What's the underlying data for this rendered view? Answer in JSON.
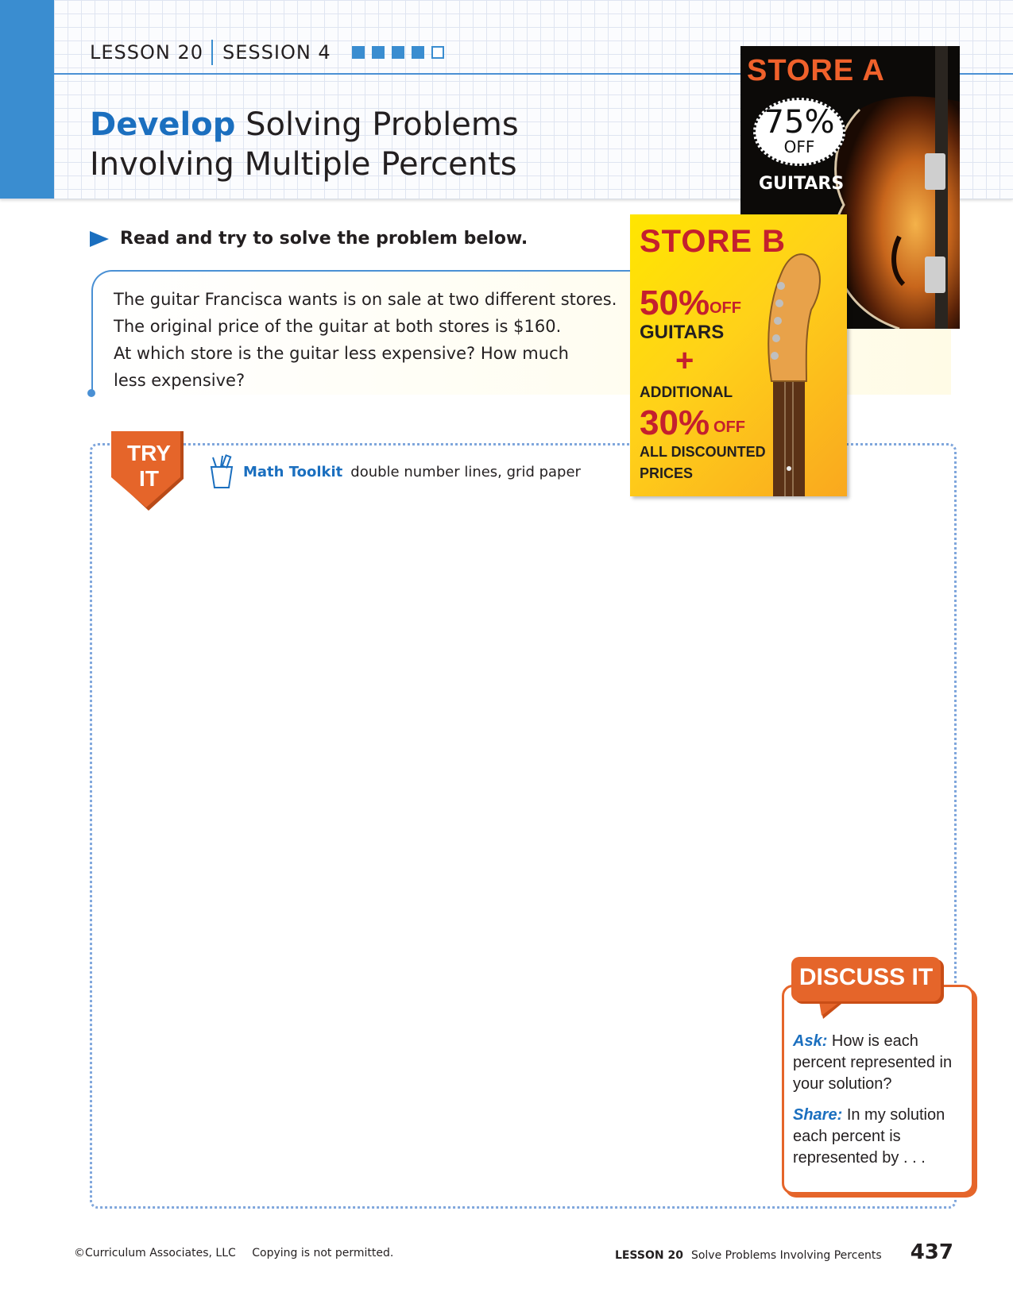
{
  "header": {
    "lesson": "LESSON 20",
    "session": "SESSION 4",
    "progress_filled": 4,
    "progress_total": 5,
    "title_bold": "Develop",
    "title_line1_rest": "Solving Problems",
    "title_line2": "Involving Multiple Percents",
    "accent_color": "#3a8dd0"
  },
  "instruction": "Read and try to solve the problem below.",
  "problem": {
    "lines": [
      "The guitar Francisca wants is on sale at two different stores.",
      "The original price of the guitar at both stores is $160.",
      "At which store is the guitar less expensive? How much",
      "less expensive?"
    ]
  },
  "store_a": {
    "title": "STORE A",
    "percent": "75%",
    "off": "OFF",
    "item": "GUITARS",
    "title_color": "#f0612b"
  },
  "store_b": {
    "title": "STORE B",
    "percent1": "50%",
    "off1": "OFF",
    "item": "GUITARS",
    "plus": "+",
    "additional": "ADDITIONAL",
    "percent2": "30%",
    "off2": "OFF",
    "discounted_line1": "ALL DISCOUNTED",
    "discounted_line2": "PRICES",
    "title_color": "#c4202e"
  },
  "try_it": {
    "badge_line1": "TRY",
    "badge_line2": "IT",
    "toolkit_label": "Math Toolkit",
    "toolkit_items": "double number lines, grid paper",
    "badge_color": "#e5652a"
  },
  "discuss": {
    "title": "DISCUSS IT",
    "ask_label": "Ask:",
    "ask_text": "How is each percent represented in your solution?",
    "share_label": "Share:",
    "share_text": "In my solution each percent is represented by . . ."
  },
  "footer": {
    "copyright": "©Curriculum Associates, LLC",
    "notice": "Copying is not permitted.",
    "lesson": "LESSON 20",
    "lesson_title": "Solve Problems Involving Percents",
    "page_number": "437"
  }
}
